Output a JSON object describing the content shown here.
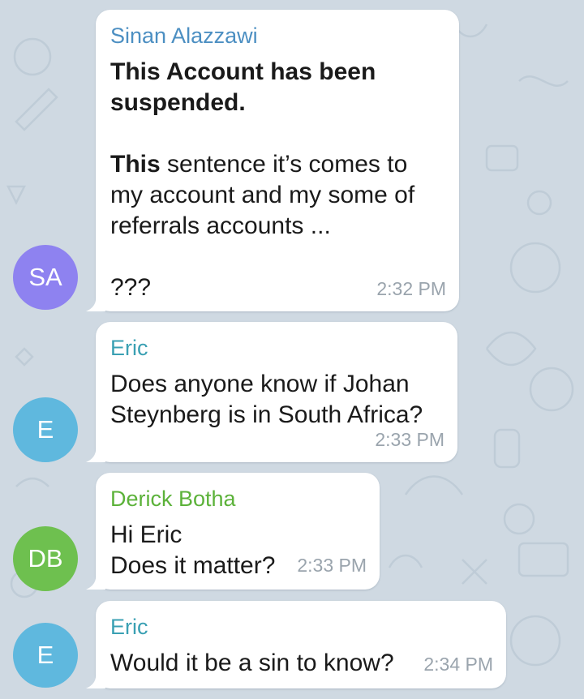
{
  "colors": {
    "background": "#cfd9e2",
    "bubble": "#ffffff",
    "time": "#9aa4ad",
    "sa_avatar": "#8e82f0",
    "e_avatar": "#5fb8de",
    "db_avatar": "#6ec04f",
    "sa_name": "#4c8fc2",
    "eric_name": "#3aa0b3",
    "derick_name": "#5cb23a"
  },
  "messages": [
    {
      "sender": "Sinan Alazzawi",
      "avatar_initials": "SA",
      "text_line1": "This Account has been suspended.",
      "text_line2_bold": "This",
      "text_line2_rest": " sentence it’s comes to my account and my some of referrals accounts ...",
      "text_line3": "???",
      "time": "2:32 PM"
    },
    {
      "sender": "Eric",
      "avatar_initials": "E",
      "text": "Does anyone know if Johan Steynberg is in South Africa?",
      "time": "2:33 PM"
    },
    {
      "sender": "Derick Botha",
      "avatar_initials": "DB",
      "text_line1": "Hi Eric",
      "text_line2": "Does it matter?",
      "time": "2:33 PM"
    },
    {
      "sender": "Eric",
      "avatar_initials": "E",
      "text": "Would it be a sin to know?",
      "time": "2:34 PM"
    }
  ]
}
